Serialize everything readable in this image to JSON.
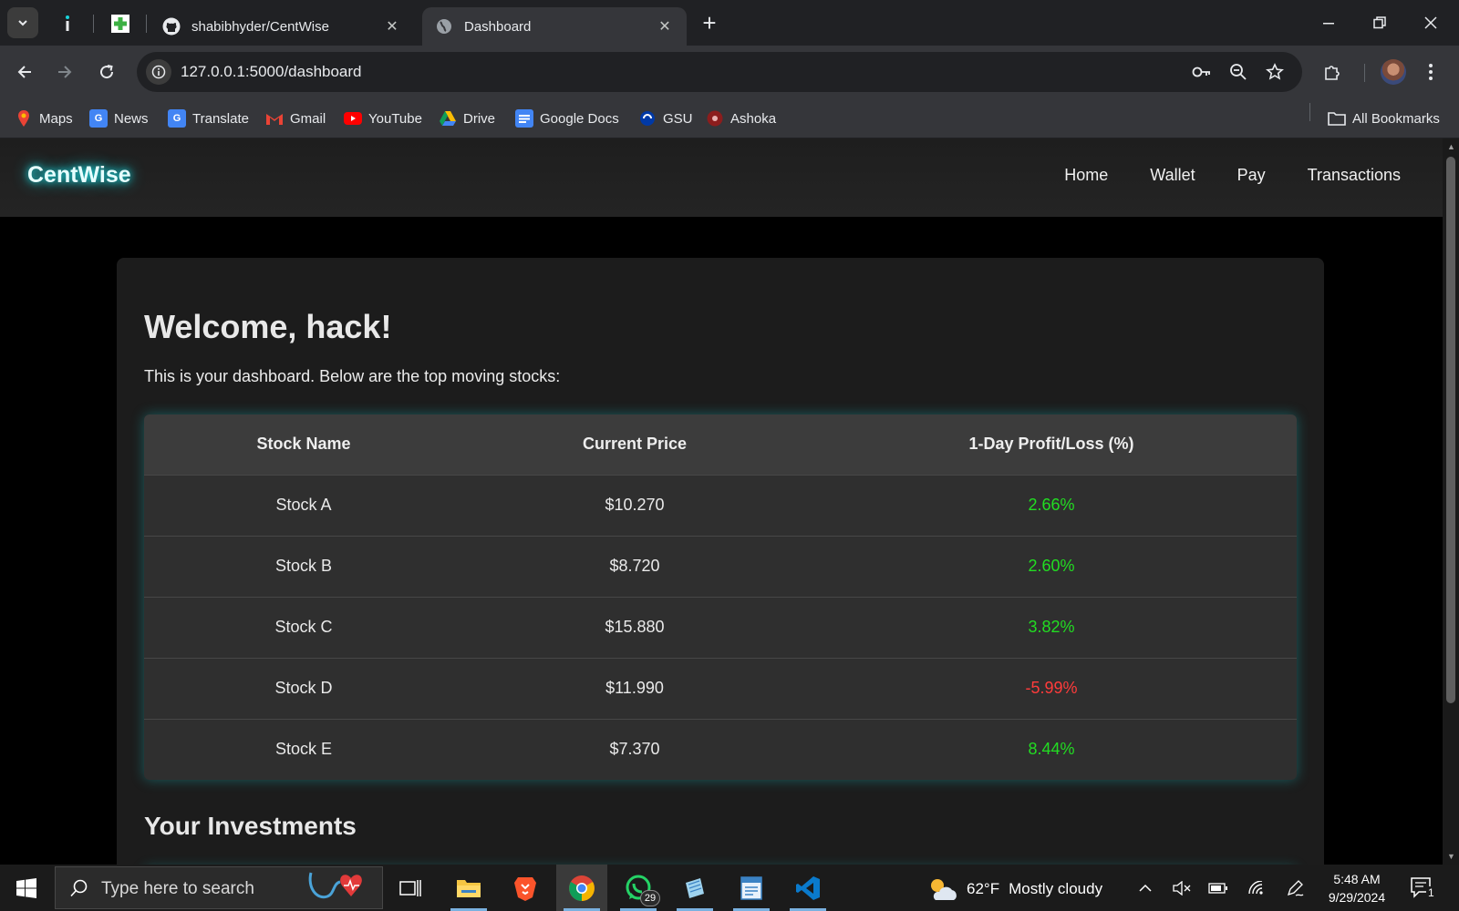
{
  "browser": {
    "tabs": [
      {
        "title": "shabibhyder/CentWise",
        "active": false
      },
      {
        "title": "Dashboard",
        "active": true
      }
    ],
    "url": "127.0.0.1:5000/dashboard",
    "bookmarks": [
      "Maps",
      "News",
      "Translate",
      "Gmail",
      "YouTube",
      "Drive",
      "Google Docs",
      "GSU",
      "Ashoka"
    ],
    "all_bookmarks": "All Bookmarks"
  },
  "app": {
    "brand": "CentWise",
    "nav": [
      "Home",
      "Wallet",
      "Pay",
      "Transactions"
    ],
    "welcome": "Welcome, hack!",
    "intro": "This is your dashboard. Below are the top moving stocks:",
    "table": {
      "headers": [
        "Stock Name",
        "Current Price",
        "1-Day Profit/Loss (%)"
      ],
      "rows": [
        {
          "name": "Stock A",
          "price": "$10.270",
          "change": "2.66%"
        },
        {
          "name": "Stock B",
          "price": "$8.720",
          "change": "2.60%"
        },
        {
          "name": "Stock C",
          "price": "$15.880",
          "change": "3.82%"
        },
        {
          "name": "Stock D",
          "price": "$11.990",
          "change": "-5.99%"
        },
        {
          "name": "Stock E",
          "price": "$7.370",
          "change": "8.44%"
        }
      ]
    },
    "investments_title": "Your Investments"
  },
  "taskbar": {
    "search_placeholder": "Type here to search",
    "whatsapp_badge": "29",
    "weather_temp": "62°F",
    "weather_desc": "Mostly cloudy",
    "time": "5:48 AM",
    "date": "9/29/2024",
    "notifications": "1"
  },
  "colors": {
    "accent_glow": "#19d3da",
    "positive": "#22dd22",
    "negative": "#ff3b3b",
    "card_bg": "#1c1c1c",
    "table_bg": "#2f2f2f"
  }
}
